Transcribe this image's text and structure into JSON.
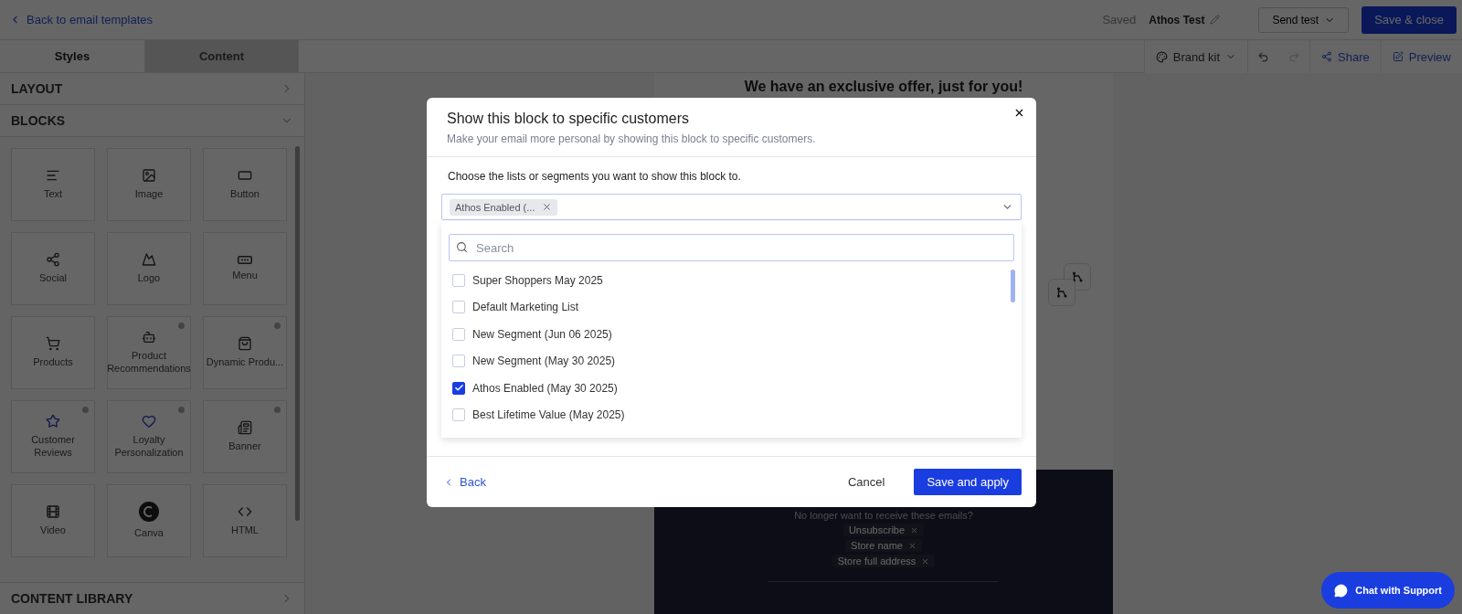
{
  "top_bar": {
    "back_link": "Back to email templates",
    "status": "Saved",
    "template_name": "Athos Test",
    "send_test": "Send test",
    "save_close": "Save & close"
  },
  "editor_tabs": [
    {
      "label": "Styles",
      "selected": true
    },
    {
      "label": "Content",
      "selected": false
    }
  ],
  "toolbar": {
    "brand_kit": "Brand kit",
    "undo_disabled": false,
    "redo_disabled": true,
    "share": "Share",
    "preview": "Preview"
  },
  "sidebar": {
    "sections": [
      {
        "title": "LAYOUT",
        "expanded": false
      },
      {
        "title": "BLOCKS",
        "expanded": true
      }
    ],
    "blocks": [
      {
        "label": "Text",
        "info": false
      },
      {
        "label": "Image",
        "info": false
      },
      {
        "label": "Button",
        "info": false
      },
      {
        "label": "Social",
        "info": false
      },
      {
        "label": "Logo",
        "info": false
      },
      {
        "label": "Menu",
        "info": false
      },
      {
        "label": "Products",
        "info": false
      },
      {
        "label": "Product Recommendations",
        "info": true
      },
      {
        "label": "Dynamic Produ...",
        "info": true
      },
      {
        "label": "Customer Reviews",
        "info": true
      },
      {
        "label": "Loyalty Personalization",
        "info": true
      },
      {
        "label": "Banner",
        "info": true
      },
      {
        "label": "Video",
        "info": false
      },
      {
        "label": "Canva",
        "info": false
      },
      {
        "label": "HTML",
        "info": false
      }
    ],
    "footer_section": {
      "title": "CONTENT LIBRARY",
      "expanded": false
    }
  },
  "email": {
    "headline": "We have an exclusive offer, just for you!",
    "footer_text": "No longer want to receive these emails?",
    "merge_tags": [
      "Unsubscribe",
      "Store name",
      "Store full address"
    ]
  },
  "modal": {
    "title": "Show this block to specific customers",
    "subtitle": "Make your email more personal by showing this block to specific customers.",
    "prompt": "Choose the lists or segments you want to show this block to.",
    "chips": [
      "Athos Enabled (..."
    ],
    "search": {
      "placeholder": "Search"
    },
    "options": [
      {
        "label": "Super Shoppers May 2025",
        "checked": false
      },
      {
        "label": "Default Marketing List",
        "checked": false
      },
      {
        "label": "New Segment (Jun 06 2025)",
        "checked": false
      },
      {
        "label": "New Segment (May 30 2025)",
        "checked": false
      },
      {
        "label": "Athos Enabled (May 30 2025)",
        "checked": true
      },
      {
        "label": "Best Lifetime Value (May 2025)",
        "checked": false
      }
    ],
    "back": "Back",
    "cancel": "Cancel",
    "save": "Save and apply"
  },
  "chat_button": "Chat with Support"
}
